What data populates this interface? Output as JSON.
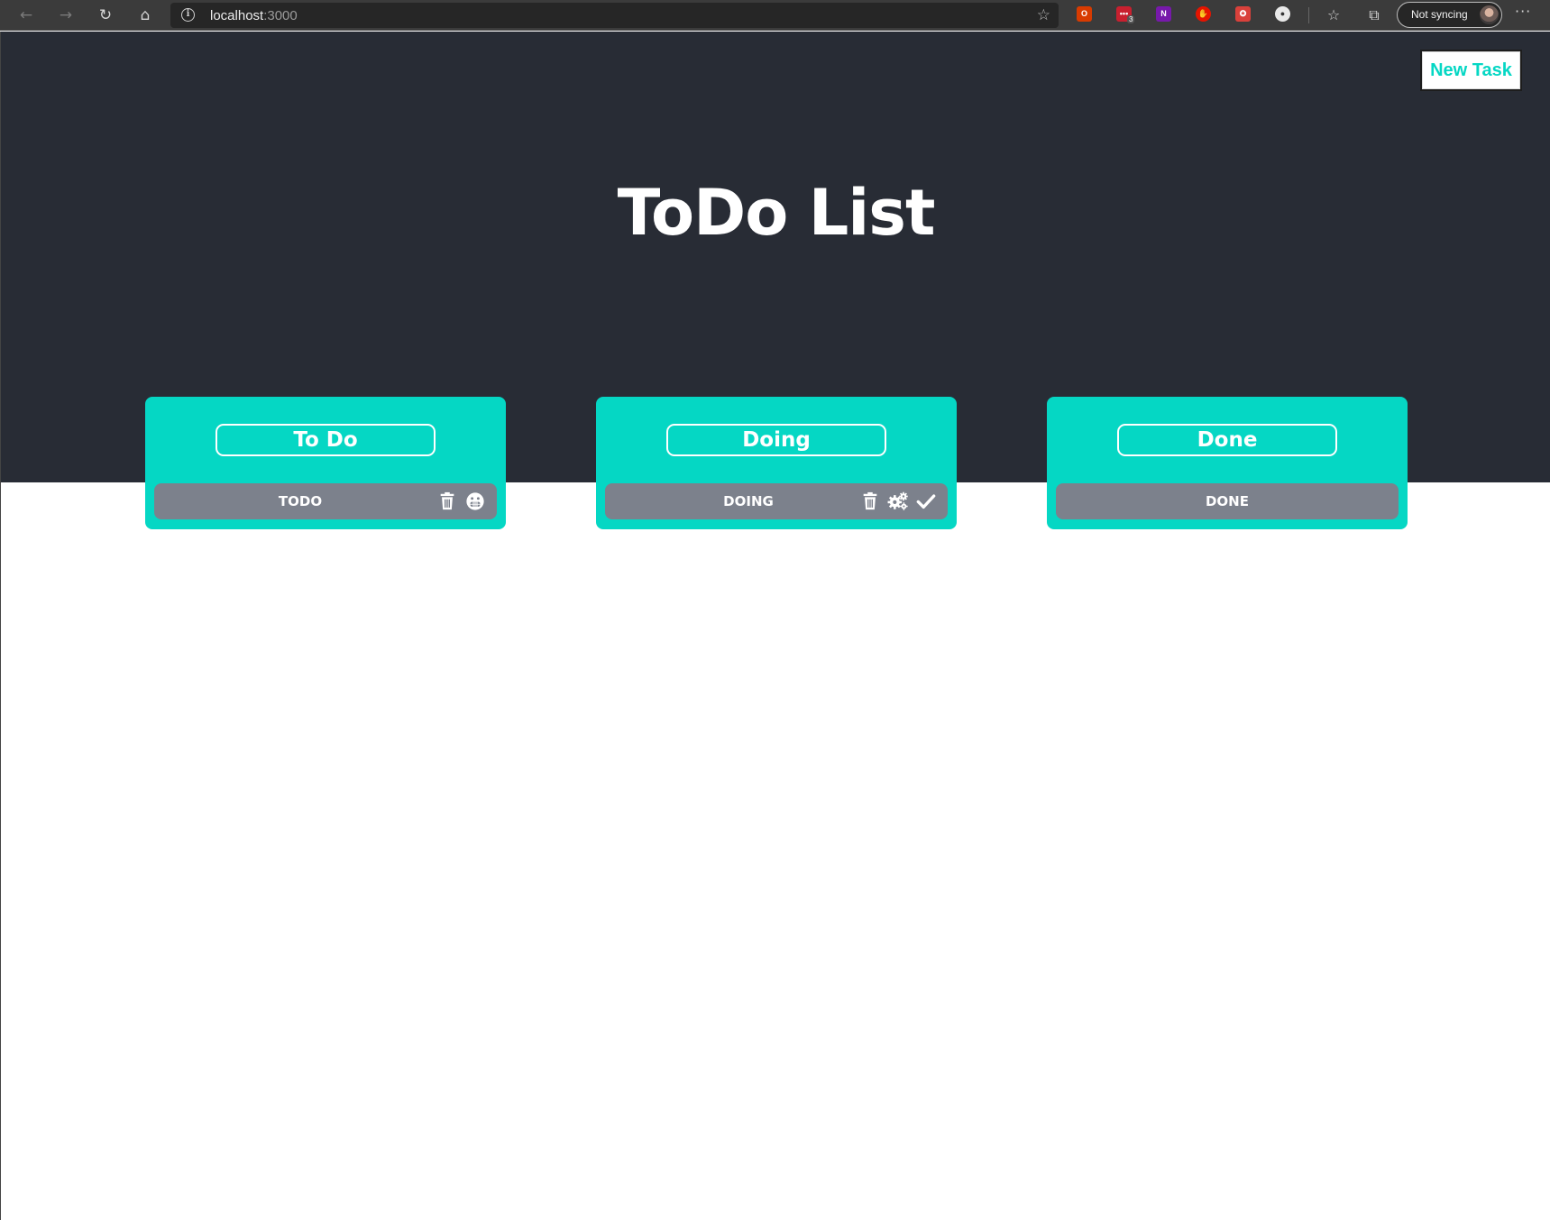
{
  "browser": {
    "url_host": "localhost",
    "url_port": ":3000",
    "ext_badge": "3",
    "profile_label": "Not syncing",
    "icons": [
      "back-icon",
      "forward-icon",
      "refresh-icon",
      "home-icon",
      "info-icon",
      "star-icon",
      "favorites-icon",
      "collections-icon",
      "more-icon"
    ]
  },
  "header": {
    "new_task_label": "New Task",
    "title": "ToDo List"
  },
  "columns": [
    {
      "heading": "To Do",
      "task": "TODO",
      "icons": [
        "trash-icon",
        "grimace-face-icon"
      ]
    },
    {
      "heading": "Doing",
      "task": "DOING",
      "icons": [
        "trash-icon",
        "cogs-icon",
        "check-icon"
      ]
    },
    {
      "heading": "Done",
      "task": "DONE",
      "icons": []
    }
  ],
  "colors": {
    "accent": "#05d7c4",
    "hero_bg": "#282c35",
    "task_bg": "#7c818c",
    "page_bg": "#ffffff"
  }
}
